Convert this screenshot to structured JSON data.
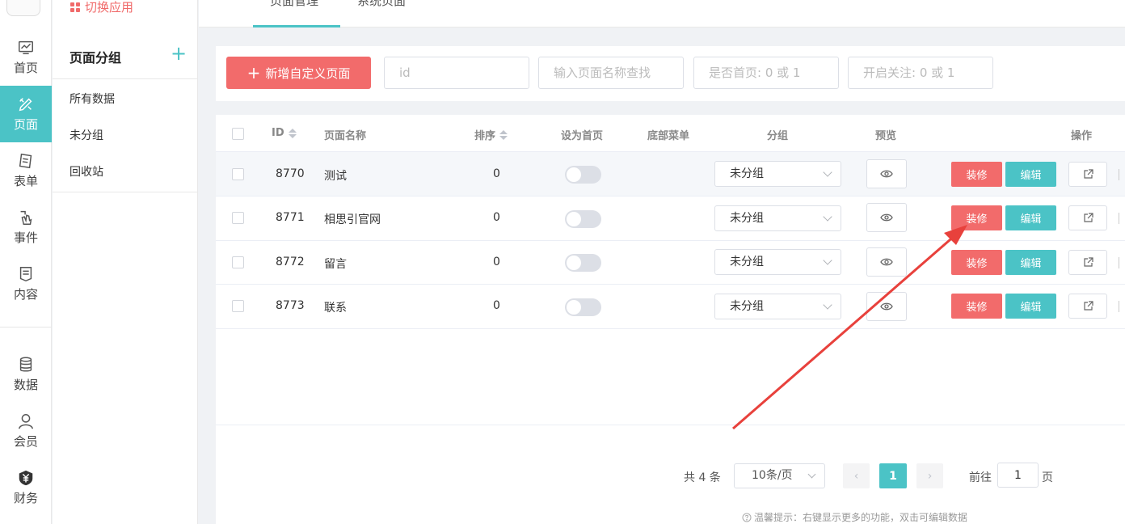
{
  "nav": {
    "items": [
      {
        "label": "首页",
        "icon": "dashboard-icon"
      },
      {
        "label": "页面",
        "icon": "page-design-icon"
      },
      {
        "label": "表单",
        "icon": "form-icon"
      },
      {
        "label": "事件",
        "icon": "event-icon"
      },
      {
        "label": "内容",
        "icon": "content-icon"
      },
      {
        "label": "数据",
        "icon": "database-icon"
      },
      {
        "label": "会员",
        "icon": "member-icon"
      },
      {
        "label": "财务",
        "icon": "finance-icon"
      }
    ],
    "active": "页面",
    "accent": "#4bc3c6"
  },
  "app_switch": {
    "label": "切换应用",
    "color": "#f06a6a"
  },
  "groups": {
    "title": "页面分组",
    "add_label": "+",
    "items": [
      "所有数据",
      "未分组",
      "回收站"
    ]
  },
  "tabs": [
    {
      "label": "页面管理",
      "active": true
    },
    {
      "label": "系统页面",
      "active": false
    }
  ],
  "toolbar": {
    "add_label": "新增自定义页面",
    "id_placeholder": "id",
    "name_placeholder": "输入页面名称查找",
    "home_placeholder": "是否首页: 0 或 1",
    "follow_placeholder": "开启关注: 0 或 1"
  },
  "table": {
    "headers": {
      "id": "ID",
      "name": "页面名称",
      "sort": "排序",
      "home": "设为首页",
      "bottom_menu": "底部菜单",
      "group": "分组",
      "preview": "预览",
      "actions": "操作"
    },
    "rows": [
      {
        "id": "8770",
        "name": "测试",
        "sort": "0",
        "home": false,
        "group": "未分组"
      },
      {
        "id": "8771",
        "name": "相思引官网",
        "sort": "0",
        "home": false,
        "group": "未分组"
      },
      {
        "id": "8772",
        "name": "留言",
        "sort": "0",
        "home": false,
        "group": "未分组"
      },
      {
        "id": "8773",
        "name": "联系",
        "sort": "0",
        "home": false,
        "group": "未分组"
      }
    ],
    "decorate_label": "装修",
    "edit_label": "编辑",
    "decorate_color": "#f26b6b",
    "edit_color": "#4bc3c6"
  },
  "pagination": {
    "total": "共 4 条",
    "page_size": "10条/页",
    "current_page": "1",
    "goto_label": "前往",
    "goto_value": "1",
    "page_unit": "页"
  },
  "tip": "温馨提示：右键显示更多的功能，双击可编辑数据",
  "annotation": {
    "color": "#e8413c"
  }
}
